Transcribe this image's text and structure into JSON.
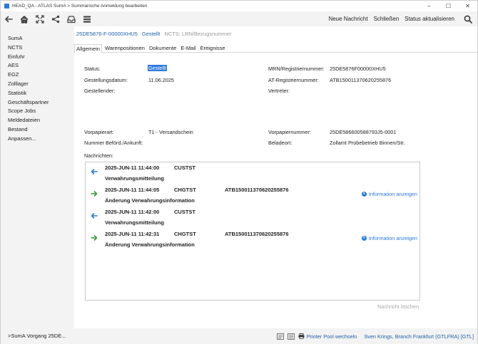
{
  "window": {
    "title": "HEAD_QA - ATLAS SumA > Summarische Anmeldung bearbeiten",
    "controls": {
      "minimize": "–",
      "maximize": "☐",
      "close": "✕"
    }
  },
  "toolbar": {
    "icons": [
      "back-icon",
      "home-icon",
      "fullscreen-icon",
      "share-icon",
      "inbox-icon",
      "list-icon"
    ],
    "actions": [
      "Neue Nachricht",
      "Schließen",
      "Status aktualisieren"
    ]
  },
  "sidebar": {
    "items": [
      "SumA",
      "NCTS",
      "Einfuhr",
      "AES",
      "EGZ",
      "Zolllager",
      "Statistik",
      "Geschäftspartner",
      "Scope Jobs",
      "Meldedateien",
      "Bestand",
      "Anpassen..."
    ],
    "bottom": ">SumA Vorgang 25DE..."
  },
  "header": {
    "reference": "25DE5876-F-00000XHU5",
    "status": "Gestellt",
    "ncts": "NCTS: LRN/Bezugsnummer"
  },
  "tabs": [
    "Allgemein",
    "Warenpositionen",
    "Dokumente",
    "E-Mail",
    "Ereignisse"
  ],
  "fields": {
    "status_label": "Status:",
    "status_value": "Gestellt",
    "gestellungsdatum_label": "Gestellungsdatum:",
    "gestellungsdatum_value": "11.06.2025",
    "gestellender_label": "Gestellender:",
    "mrn_label": "MRN/Registriernummer:",
    "mrn_value": "25DE5876F00000XHU5",
    "at_label": "AT-Registriernummer:",
    "at_value": "ATB150011370620255876",
    "vertreter_label": "Vertreter:",
    "vorpapierart_label": "Vorpapierart:",
    "vorpapierart_value": "T1 - Versandschein",
    "befoerd_label": "Nummer Beförd./Ankunft:",
    "vorpapiernummer_label": "Vorpapiernummer:",
    "vorpapiernummer_value": "25DE586600588793J5-0001",
    "beladeort_label": "Beladeort:",
    "beladeort_value": "Zollamt Probebetrieb Binnen/Str.",
    "nachrichten_label": "Nachrichten:"
  },
  "messages": [
    {
      "direction": "in",
      "timestamp": "2025-JUN-11 11:44:00",
      "type": "CUSTST",
      "ref": "",
      "description": "Verwahrungsmitteilung",
      "info": ""
    },
    {
      "direction": "out",
      "timestamp": "2025-JUN-11 11:44:05",
      "type": "CHGTST",
      "ref": "ATB150011370620255876",
      "description": "Änderung Verwahrungsinformation",
      "info": "Information anzeigen"
    },
    {
      "direction": "in",
      "timestamp": "2025-JUN-11 11:42:00",
      "type": "CUSTST",
      "ref": "",
      "description": "Verwahrungsmitteilung",
      "info": ""
    },
    {
      "direction": "out",
      "timestamp": "2025-JUN-11 11:42:31",
      "type": "CHGTST",
      "ref": "ATB150011370620255876",
      "description": "Änderung Verwahrungsinformation",
      "info": "Information anzeigen"
    }
  ],
  "delete_button": "Nachricht löschen",
  "statusbar": {
    "printer": "Printer Pool wechseln",
    "user": "Sven Krings, Branch Frankfurt (GTLFRA) [GTL]"
  },
  "colors": {
    "accent": "#2b7bd8",
    "link": "#1f5fa8",
    "in_arrow": "#2b7bd8",
    "out_arrow": "#3a9b3a",
    "highlight": "#2e7be0"
  }
}
